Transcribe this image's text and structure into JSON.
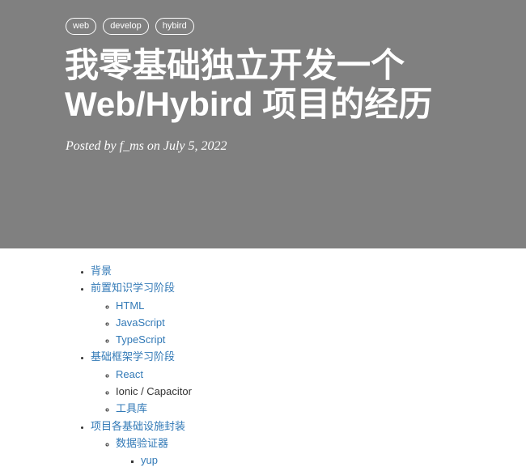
{
  "post": {
    "tags": [
      "web",
      "develop",
      "hybird"
    ],
    "title_line1": "我零基础独立开发一个",
    "title_line2": "Web/Hybird 项目的经历",
    "meta": "Posted by f_ms on July 5, 2022"
  },
  "toc": {
    "items": [
      {
        "label": "背景"
      },
      {
        "label": "前置知识学习阶段",
        "children": [
          {
            "label": "HTML"
          },
          {
            "label": "JavaScript"
          },
          {
            "label": "TypeScript"
          }
        ]
      },
      {
        "label": "基础框架学习阶段",
        "children": [
          {
            "label": "React"
          },
          {
            "label": "Ionic / Capacitor"
          },
          {
            "label": "工具库"
          }
        ]
      },
      {
        "label": "项目各基础设施封装",
        "children": [
          {
            "label": "数据验证器",
            "children": [
              {
                "label": "yup"
              }
            ]
          }
        ]
      }
    ]
  }
}
